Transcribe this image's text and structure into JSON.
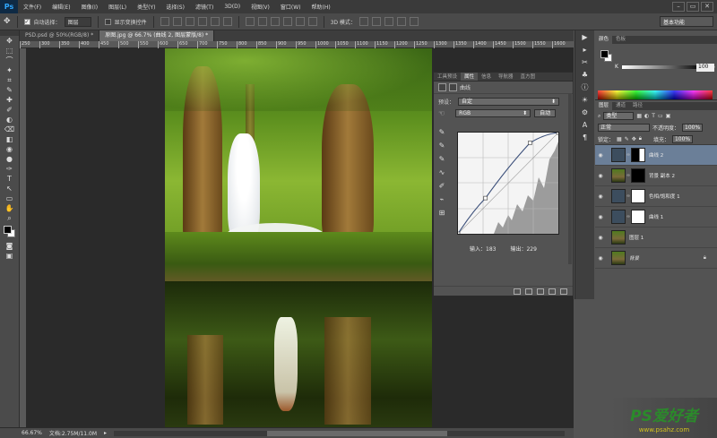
{
  "app": {
    "logo": "Ps",
    "menus": [
      "文件(F)",
      "编辑(E)",
      "图像(I)",
      "图层(L)",
      "类型(Y)",
      "选择(S)",
      "滤镜(T)",
      "3D(D)",
      "视图(V)",
      "窗口(W)",
      "帮助(H)"
    ],
    "window_buttons": [
      "–",
      "▭",
      "✕"
    ]
  },
  "options": {
    "auto_select_label": "自动选择：",
    "auto_select_value": "图层",
    "show_transform_label": "显示变换控件",
    "mode_3d_label": "3D 模式：",
    "workspace": "基本功能"
  },
  "tabs": [
    {
      "label": "PSD.psd @ 50%(RGB/8) *",
      "active": false
    },
    {
      "label": "原图.jpg @ 66.7% (曲线 2, 图层蒙版/8) *",
      "active": true
    }
  ],
  "ruler_ticks": [
    "250",
    "300",
    "350",
    "400",
    "450",
    "500",
    "550",
    "600",
    "650",
    "700",
    "750",
    "800",
    "850",
    "900",
    "950",
    "1000",
    "1050",
    "1100",
    "1150",
    "1200",
    "1250",
    "1300",
    "1350",
    "1400",
    "1450",
    "1500",
    "1550",
    "1600"
  ],
  "tools": [
    "✥",
    "⬚",
    "⌒",
    "✦",
    "⌗",
    "✎",
    "✚",
    "✐",
    "◐",
    "⌫",
    "◧",
    "◉",
    "●",
    "✑",
    "T",
    "↖",
    "▭",
    "✋",
    "⌕"
  ],
  "properties": {
    "tabs": [
      "工具预设",
      "属性",
      "信息",
      "导航器",
      "直方图"
    ],
    "active_tab": "属性",
    "title": "曲线",
    "preset_label": "预设：",
    "preset_value": "自定",
    "channel_value": "RGB",
    "auto_button": "自动",
    "input_label": "输入：",
    "input_value": "183",
    "output_label": "输出：",
    "output_value": "229",
    "curve_tools": [
      "✎",
      "✎",
      "✎",
      "∿",
      "✐",
      "⌁",
      "⊞"
    ]
  },
  "color_panel": {
    "tabs": [
      "颜色",
      "色板"
    ],
    "k_label": "K",
    "k_value": "100",
    "k_unit": "%"
  },
  "layers_panel": {
    "tabs": [
      "图层",
      "通道",
      "路径"
    ],
    "kind_value": "类型",
    "blend_value": "正常",
    "opacity_label": "不透明度：",
    "opacity_value": "100%",
    "lock_label": "锁定：",
    "fill_label": "填充：",
    "fill_value": "100%",
    "layers": [
      {
        "name": "曲线 2",
        "selected": true
      },
      {
        "name": "背景 副本 2",
        "selected": false
      },
      {
        "name": "色相/饱和度 1",
        "selected": false
      },
      {
        "name": "曲线 1",
        "selected": false
      },
      {
        "name": "图层 1",
        "selected": false
      },
      {
        "name": "背景",
        "selected": false,
        "locked": true
      }
    ]
  },
  "status": {
    "zoom": "66.67%",
    "doc_info": "文档:2.75M/11.0M"
  },
  "watermark": {
    "title": "PS爱好者",
    "url": "www.psahz.com"
  },
  "colors": {
    "accent": "#6b7f98",
    "panel_bg": "#535353",
    "menubar_bg": "#3a3a3a"
  },
  "curve": {
    "points": [
      [
        0,
        0
      ],
      [
        70,
        90
      ],
      [
        183,
        229
      ],
      [
        255,
        255
      ]
    ],
    "range": [
      0,
      255
    ]
  }
}
